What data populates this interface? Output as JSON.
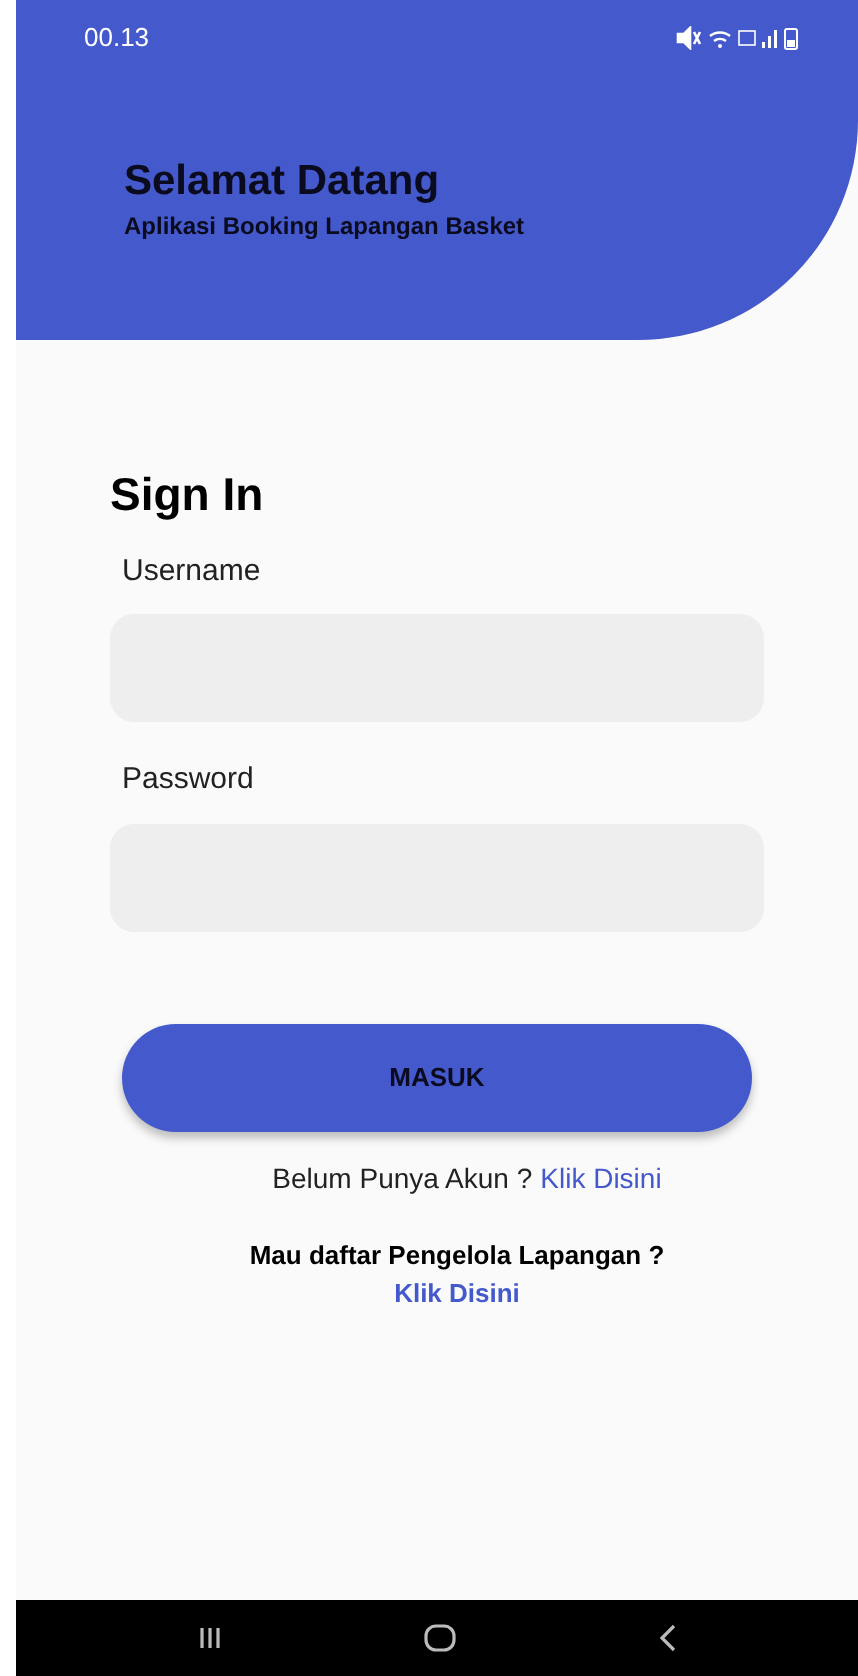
{
  "status_bar": {
    "time": "00.13"
  },
  "header": {
    "title": "Selamat Datang",
    "subtitle": "Aplikasi Booking Lapangan Basket"
  },
  "form": {
    "title": "Sign In",
    "fields": [
      {
        "label": "Username"
      },
      {
        "label": "Password"
      }
    ],
    "submit": "MASUK"
  },
  "register": {
    "question": "Belum Punya Akun ?",
    "link": "Klik Disini"
  },
  "manager": {
    "question": "Mau daftar Pengelola Lapangan ?",
    "link": "Klik Disini"
  }
}
